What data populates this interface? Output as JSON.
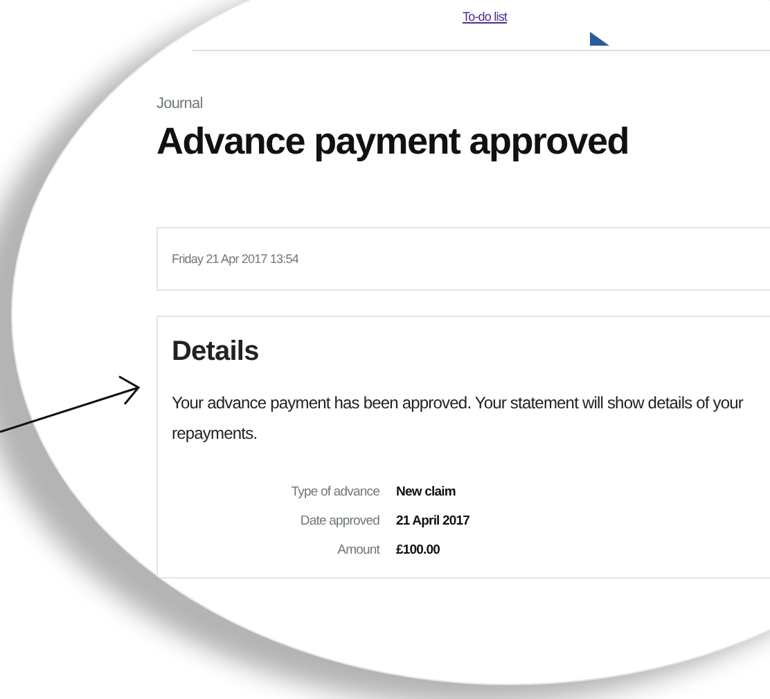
{
  "nav": {
    "link": "To-do list"
  },
  "breadcrumb": "Journal",
  "title": "Advance payment approved",
  "timestamp": "Friday 21 Apr 2017 13:54",
  "details": {
    "heading": "Details",
    "message": "Your advance payment has been approved. Your statement will show details of your repayments.",
    "rows": [
      {
        "label": "Type of advance",
        "value": "New claim"
      },
      {
        "label": "Date approved",
        "value": "21 April 2017"
      },
      {
        "label": "Amount",
        "value": "£100.00"
      }
    ]
  }
}
